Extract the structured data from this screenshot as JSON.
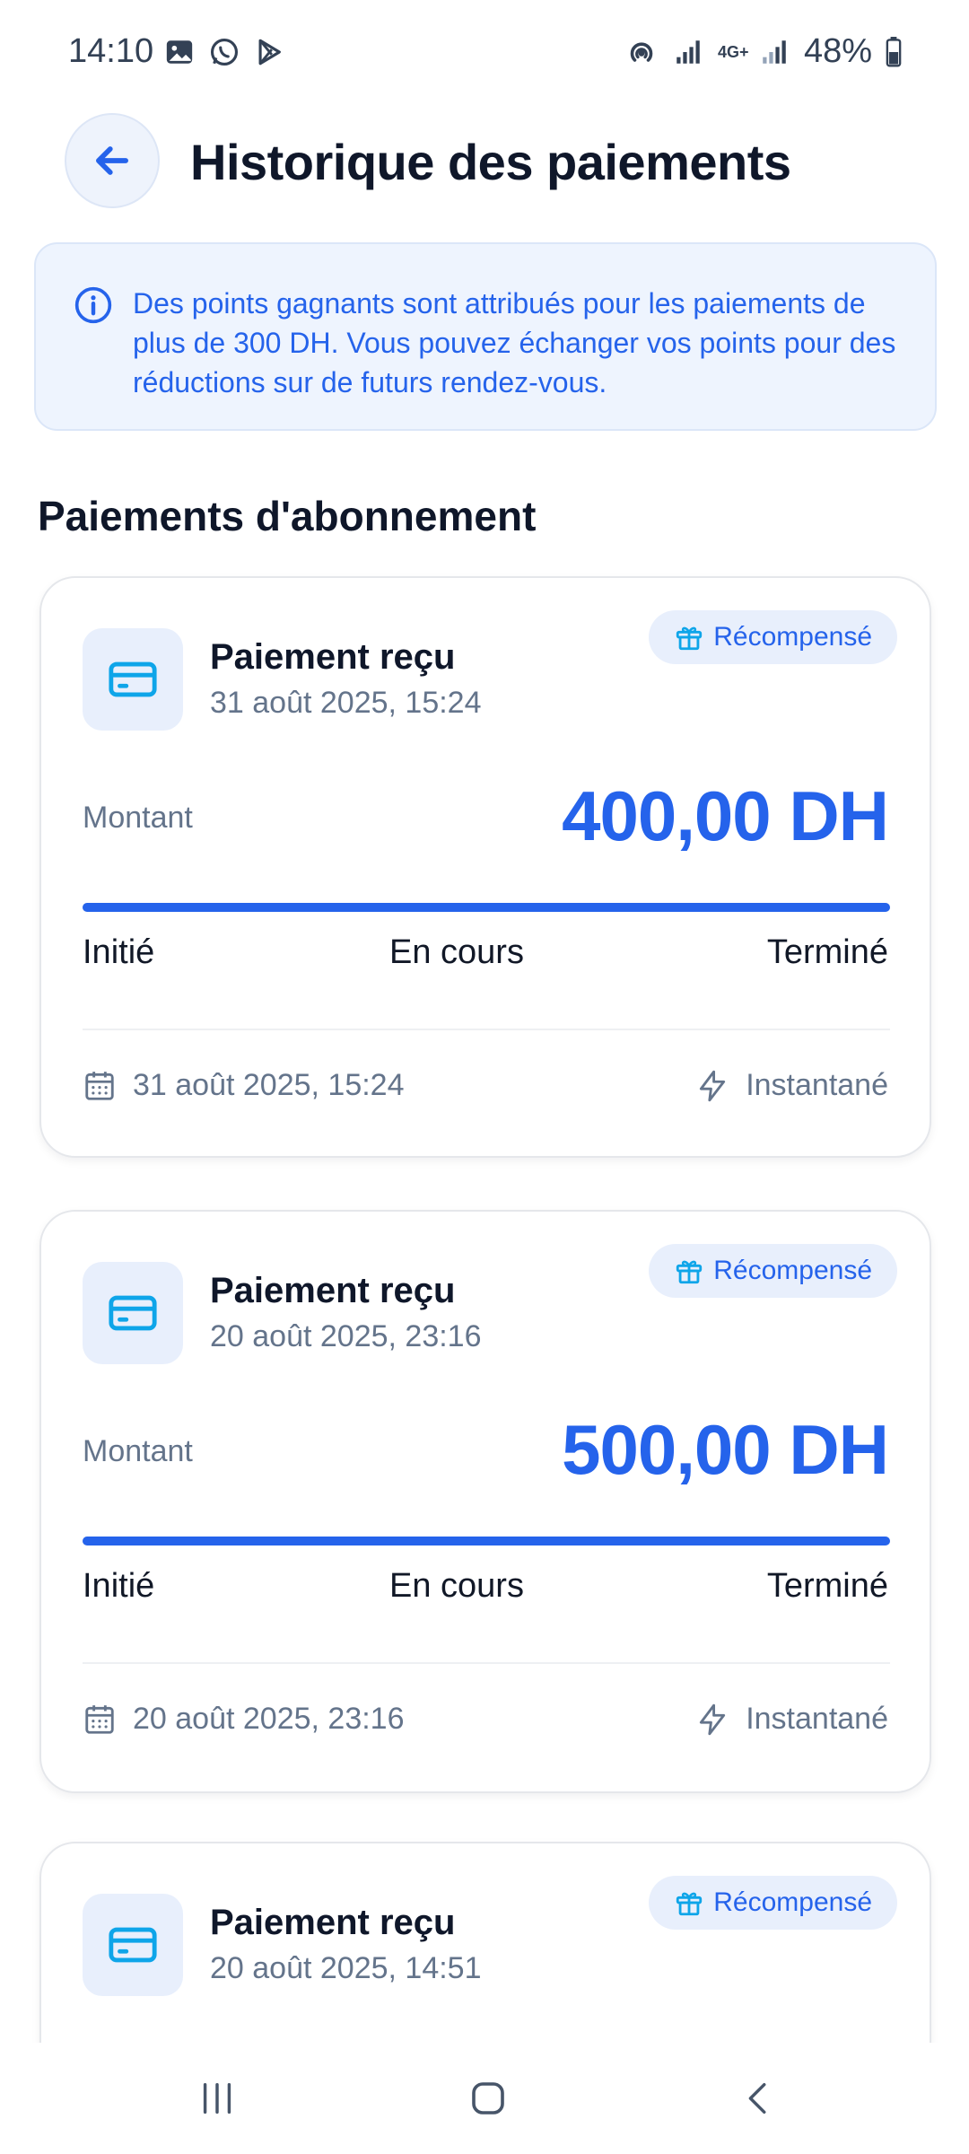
{
  "status_bar": {
    "time": "14:10",
    "battery": "48%",
    "network": "4G+",
    "icons": [
      "gallery-icon",
      "whatsapp-icon",
      "play-store-icon",
      "hotspot-icon",
      "signal-icon",
      "battery-icon"
    ]
  },
  "header": {
    "title": "Historique des paiements",
    "back_icon": "arrow-left-icon"
  },
  "info_banner": {
    "text": "Des points gagnants sont attribués pour les paiements de plus de 300 DH. Vous pouvez échanger vos points pour des réductions sur de futurs rendez-vous."
  },
  "section": {
    "title": "Paiements d'abonnement"
  },
  "payments": [
    {
      "title": "Paiement reçu",
      "date": "31 août 2025, 15:24",
      "badge": "Récompensé",
      "amount_label": "Montant",
      "amount": "400,00 DH",
      "progress": 1.0,
      "steps": [
        "Initié",
        "En cours",
        "Terminé"
      ],
      "footer_date": "31 août 2025, 15:24",
      "speed": "Instantané"
    },
    {
      "title": "Paiement reçu",
      "date": "20 août 2025, 23:16",
      "badge": "Récompensé",
      "amount_label": "Montant",
      "amount": "500,00 DH",
      "progress": 1.0,
      "steps": [
        "Initié",
        "En cours",
        "Terminé"
      ],
      "footer_date": "20 août 2025, 23:16",
      "speed": "Instantané"
    },
    {
      "title": "Paiement reçu",
      "date": "20 août 2025, 14:51",
      "badge": "Récompensé"
    }
  ],
  "colors": {
    "accent": "#2563eb",
    "title": "#0f172a",
    "muted": "#64748b",
    "banner_bg": "#eef4fe",
    "icon_bg": "#e8effc",
    "icon_cyan": "#0ea5e9"
  }
}
